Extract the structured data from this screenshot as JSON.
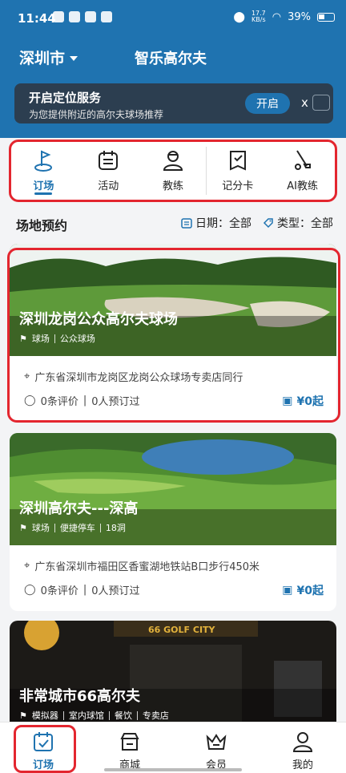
{
  "status_bar": {
    "time": "11:44",
    "net_speed_top": "17.7",
    "net_speed_bottom": "KB/s",
    "battery": "39%"
  },
  "header": {
    "city": "深圳市",
    "title": "智乐高尔夫"
  },
  "location_banner": {
    "title": "开启定位服务",
    "subtitle": "为您提供附近的高尔夫球场推荐",
    "button": "开启",
    "close": "x"
  },
  "quick_nav": [
    {
      "label": "订场",
      "icon": "golf-flag-icon",
      "active": true
    },
    {
      "label": "活动",
      "icon": "calendar-list-icon",
      "active": false
    },
    {
      "label": "教练",
      "icon": "coach-icon",
      "active": false
    },
    {
      "label": "记分卡",
      "icon": "scorecard-icon",
      "active": false
    },
    {
      "label": "AI教练",
      "icon": "golf-club-icon",
      "active": false
    }
  ],
  "section": {
    "title": "场地预约",
    "date_label": "日期：全部",
    "type_label": "类型：全部"
  },
  "courses": [
    {
      "name": "深圳龙岗公众高尔夫球场",
      "tags": [
        "球场",
        "公众球场"
      ],
      "address": "广东省深圳市龙岗区龙岗公众球场专卖店同行",
      "reviews": "0条评价",
      "bookings": "0人预订过",
      "price": "¥0起"
    },
    {
      "name": "深圳高尔夫---深高",
      "tags": [
        "球场",
        "便捷停车",
        "18洞"
      ],
      "address": "广东省深圳市福田区香蜜湖地铁站B口步行450米",
      "reviews": "0条评价",
      "bookings": "0人预订过",
      "price": "¥0起"
    },
    {
      "name": "非常城市66高尔夫",
      "tags": [
        "模拟器",
        "室内球馆",
        "餐饮",
        "专卖店"
      ],
      "sign_text": "66 GOLF CITY"
    }
  ],
  "tab_bar": [
    {
      "label": "订场",
      "icon": "calendar-check-icon",
      "active": true
    },
    {
      "label": "商城",
      "icon": "store-icon",
      "active": false
    },
    {
      "label": "会员",
      "icon": "crown-icon",
      "active": false
    },
    {
      "label": "我的",
      "icon": "user-icon",
      "active": false
    }
  ],
  "colors": {
    "brand": "#1f73b0",
    "highlight": "#e3262f"
  }
}
